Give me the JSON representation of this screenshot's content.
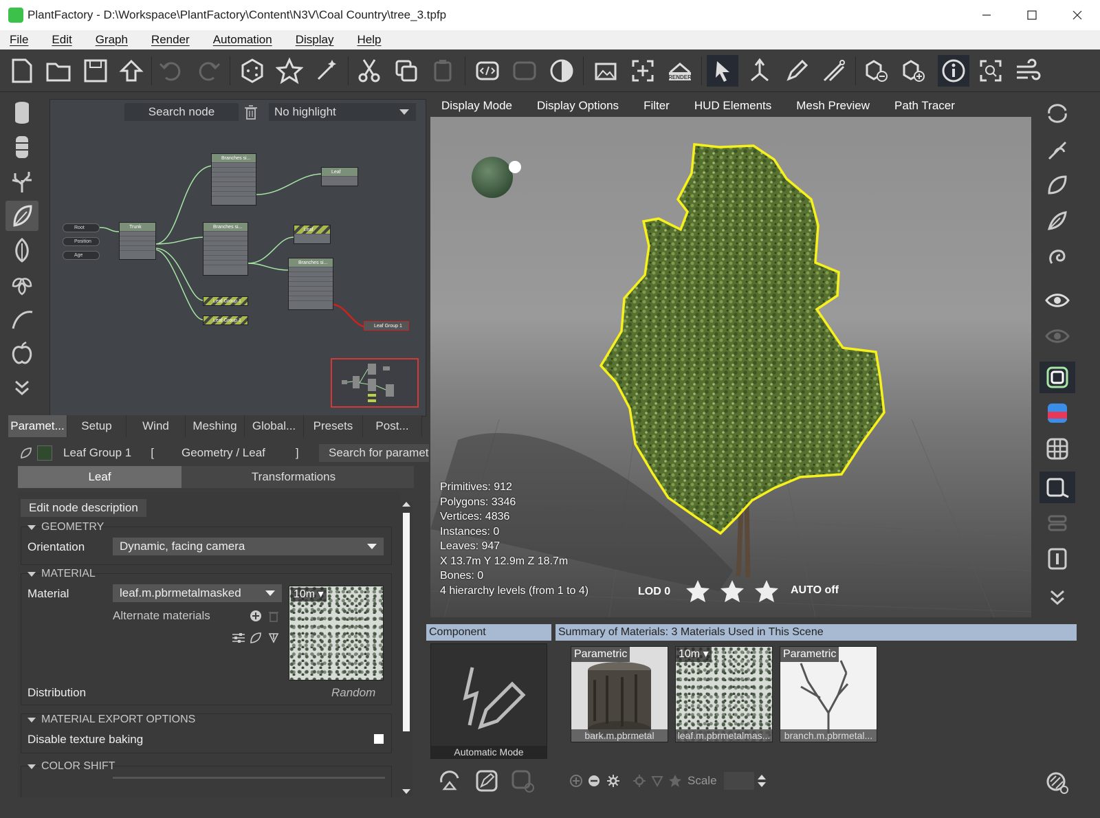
{
  "window": {
    "title": "PlantFactory - D:\\Workspace\\PlantFactory\\Content\\N3V\\Coal Country\\tree_3.tpfp"
  },
  "menu": [
    "File",
    "Edit",
    "Graph",
    "Render",
    "Automation",
    "Display",
    "Help"
  ],
  "toolbar": {
    "render_label": "RENDER"
  },
  "graph": {
    "search_label": "Search node",
    "highlight_value": "No highlight",
    "nodes": {
      "root": "Root",
      "position": "Position",
      "age": "Age",
      "trunk": "Trunk",
      "branches1": "Branches si...",
      "branches2": "Branches si...",
      "branches3": "Branches si...",
      "leaf1": "Leaf",
      "leaf2": "Leaf",
      "leafgroup_a": "Leaf Group 1",
      "leafgroup_b": "Leaf Group 1",
      "leafgroup_c": "Leaf Group 1"
    }
  },
  "param_tabs": [
    "Paramet...",
    "Setup",
    "Wind",
    "Meshing",
    "Global...",
    "Presets",
    "Post..."
  ],
  "crumb": {
    "node": "Leaf Group 1",
    "open": "[",
    "path": "Geometry / Leaf",
    "close": "]",
    "search": "Search for paramet"
  },
  "subtabs": [
    "Leaf",
    "Transformations"
  ],
  "panel": {
    "edit_desc": "Edit node description",
    "geometry": "GEOMETRY",
    "orientation_label": "Orientation",
    "orientation_value": "Dynamic, facing camera",
    "material_section": "MATERIAL",
    "material_label": "Material",
    "material_value": "leaf.m.pbrmetalmasked",
    "material_preview_tag": "10m",
    "alternate": "Alternate materials",
    "distribution_label": "Distribution",
    "distribution_value": "Random",
    "export_section": "MATERIAL EXPORT OPTIONS",
    "disable_baking": "Disable texture baking",
    "color_shift": "COLOR SHIFT"
  },
  "view_tabs": [
    "Display Mode",
    "Display Options",
    "Filter",
    "HUD Elements",
    "Mesh Preview",
    "Path Tracer"
  ],
  "hud": {
    "primitives": "Primitives: 912",
    "polygons": "Polygons: 3346",
    "vertices": "Vertices: 4836",
    "instances": "Instances: 0",
    "leaves": "Leaves: 947",
    "dimensions": "X 13.7m Y 12.9m Z 18.7m",
    "bones": "Bones: 0",
    "hierarchy": "4 hierarchy levels (from 1 to 4)",
    "lod": "LOD 0",
    "auto": "AUTO off"
  },
  "component": {
    "header": "Component",
    "mode": "Automatic Mode"
  },
  "materials": {
    "header": "Summary of Materials: 3 Materials Used in This Scene",
    "items": [
      {
        "tag": "Parametric",
        "name": "bark.m.pbrmetal"
      },
      {
        "tag": "10m",
        "name": "leaf.m.pbrmetalmas..."
      },
      {
        "tag": "Parametric",
        "name": "branch.m.pbrmetal..."
      }
    ],
    "scale_label": "Scale"
  },
  "colors": {
    "selection": "#f5f01e",
    "accent": "#a7bad2",
    "graph_bg": "#414449"
  }
}
